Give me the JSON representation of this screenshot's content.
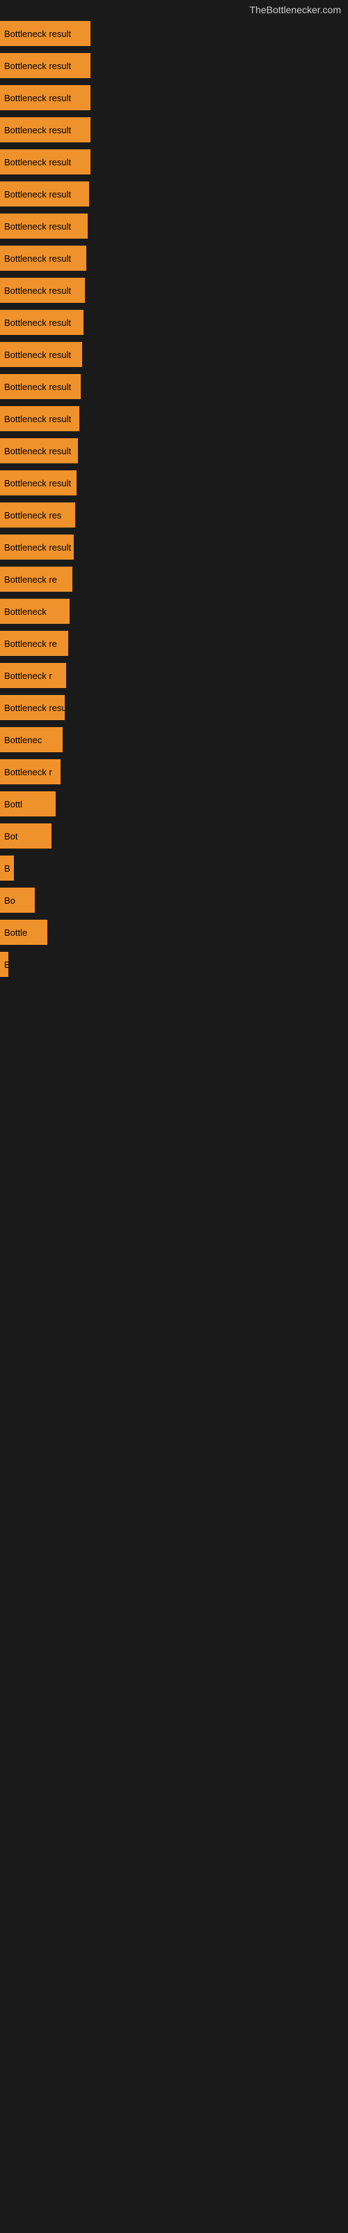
{
  "site_title": "TheBottlenecker.com",
  "accent_color": "#f0922b",
  "bars": [
    {
      "label": "Bottleneck result",
      "width": 130,
      "visible_label": "Bottleneck result"
    },
    {
      "label": "Bottleneck result",
      "width": 130,
      "visible_label": "Bottleneck result"
    },
    {
      "label": "Bottleneck result",
      "width": 130,
      "visible_label": "Bottleneck result"
    },
    {
      "label": "Bottleneck result",
      "width": 130,
      "visible_label": "Bottleneck result"
    },
    {
      "label": "Bottleneck result",
      "width": 130,
      "visible_label": "Bottleneck result"
    },
    {
      "label": "Bottleneck result",
      "width": 128,
      "visible_label": "Bottleneck result"
    },
    {
      "label": "Bottleneck result",
      "width": 126,
      "visible_label": "Bottleneck result"
    },
    {
      "label": "Bottleneck result",
      "width": 124,
      "visible_label": "Bottleneck result"
    },
    {
      "label": "Bottleneck result",
      "width": 122,
      "visible_label": "Bottleneck result"
    },
    {
      "label": "Bottleneck result",
      "width": 120,
      "visible_label": "Bottleneck result"
    },
    {
      "label": "Bottleneck result",
      "width": 118,
      "visible_label": "Bottleneck result"
    },
    {
      "label": "Bottleneck result",
      "width": 116,
      "visible_label": "Bottleneck result"
    },
    {
      "label": "Bottleneck result",
      "width": 114,
      "visible_label": "Bottleneck result"
    },
    {
      "label": "Bottleneck result",
      "width": 112,
      "visible_label": "Bottleneck result"
    },
    {
      "label": "Bottleneck result",
      "width": 110,
      "visible_label": "Bottleneck result"
    },
    {
      "label": "Bottleneck result",
      "width": 108,
      "visible_label": "Bottleneck res"
    },
    {
      "label": "Bottleneck result",
      "width": 106,
      "visible_label": "Bottleneck result"
    },
    {
      "label": "Bottleneck result",
      "width": 104,
      "visible_label": "Bottleneck re"
    },
    {
      "label": "Bottleneck result",
      "width": 100,
      "visible_label": "Bottleneck"
    },
    {
      "label": "Bottleneck result",
      "width": 98,
      "visible_label": "Bottleneck re"
    },
    {
      "label": "Bottleneck result",
      "width": 95,
      "visible_label": "Bottleneck r"
    },
    {
      "label": "Bottleneck result",
      "width": 93,
      "visible_label": "Bottleneck resu"
    },
    {
      "label": "Bottleneck result",
      "width": 90,
      "visible_label": "Bottlenec"
    },
    {
      "label": "Bottleneck result",
      "width": 87,
      "visible_label": "Bottleneck r"
    },
    {
      "label": "Bottleneck result",
      "width": 80,
      "visible_label": "Bottl"
    },
    {
      "label": "Bottleneck result",
      "width": 74,
      "visible_label": "Bot"
    },
    {
      "label": "Bottleneck result",
      "width": 20,
      "visible_label": "B"
    },
    {
      "label": "Bottleneck result",
      "width": 50,
      "visible_label": "Bo"
    },
    {
      "label": "Bottleneck result",
      "width": 68,
      "visible_label": "Bottle"
    },
    {
      "label": "Bottleneck result",
      "width": 12,
      "visible_label": "B"
    }
  ]
}
